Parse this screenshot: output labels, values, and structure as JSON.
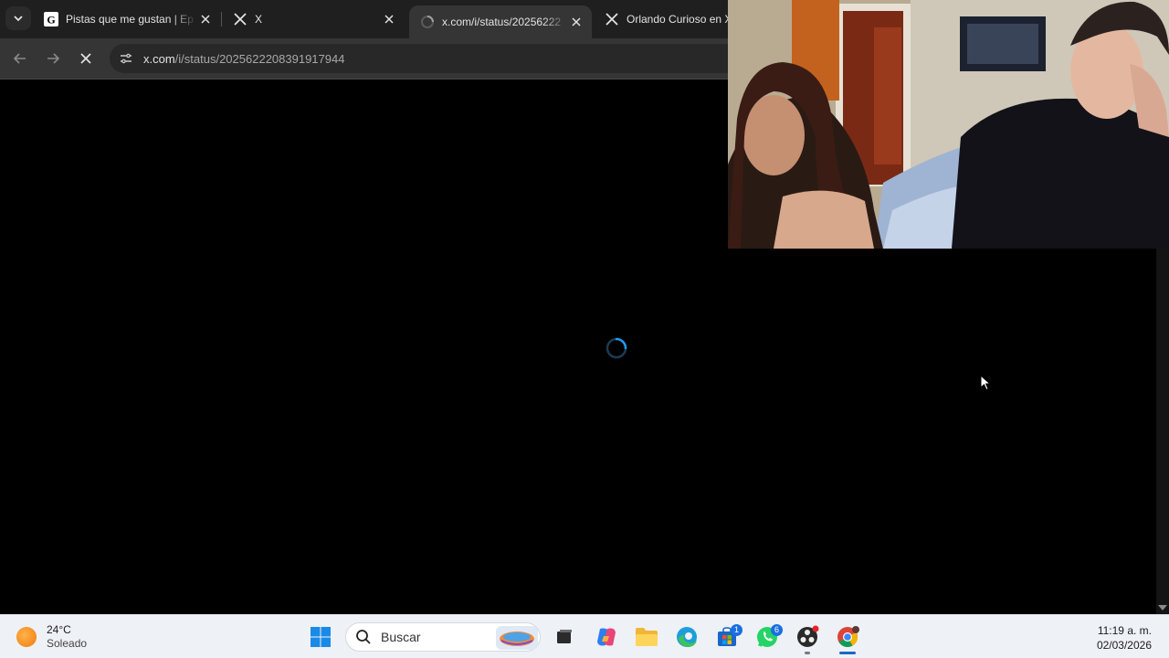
{
  "browser": {
    "tabs": [
      {
        "title": "Pistas que me gustan | Ep",
        "favicon": "genius-icon",
        "active": false,
        "closable": true
      },
      {
        "title": "X",
        "favicon": "x-logo-icon",
        "active": false,
        "closable": true
      },
      {
        "title": "x.com/i/status/20256222",
        "favicon": "loading-icon",
        "active": true,
        "closable": true
      },
      {
        "title": "Orlando Curioso en X",
        "favicon": "x-logo-icon",
        "active": false,
        "closable": false
      }
    ],
    "url_host": "x.com",
    "url_path": "/i/status/2025622208391917944",
    "loading": true
  },
  "colors": {
    "accent_spinner": "#1d9bf0",
    "tab_active_bg": "#353535",
    "tab_strip_bg": "#1f1f1f",
    "taskbar_bg": "#eef1f6"
  },
  "webcam_overlay": {
    "visible": true
  },
  "taskbar": {
    "weather": {
      "temp": "24°C",
      "desc": "Soleado"
    },
    "search_placeholder": "Buscar",
    "pinned": [
      {
        "name": "start-icon"
      },
      {
        "name": "task-view-icon"
      },
      {
        "name": "copilot-icon"
      },
      {
        "name": "file-explorer-icon"
      },
      {
        "name": "edge-icon"
      },
      {
        "name": "microsoft-store-icon",
        "badge": "1"
      },
      {
        "name": "whatsapp-icon",
        "badge": "6"
      },
      {
        "name": "obs-icon"
      },
      {
        "name": "chrome-icon"
      }
    ],
    "clock": {
      "time": "11:19 a. m.",
      "date": "02/03/2026"
    }
  }
}
